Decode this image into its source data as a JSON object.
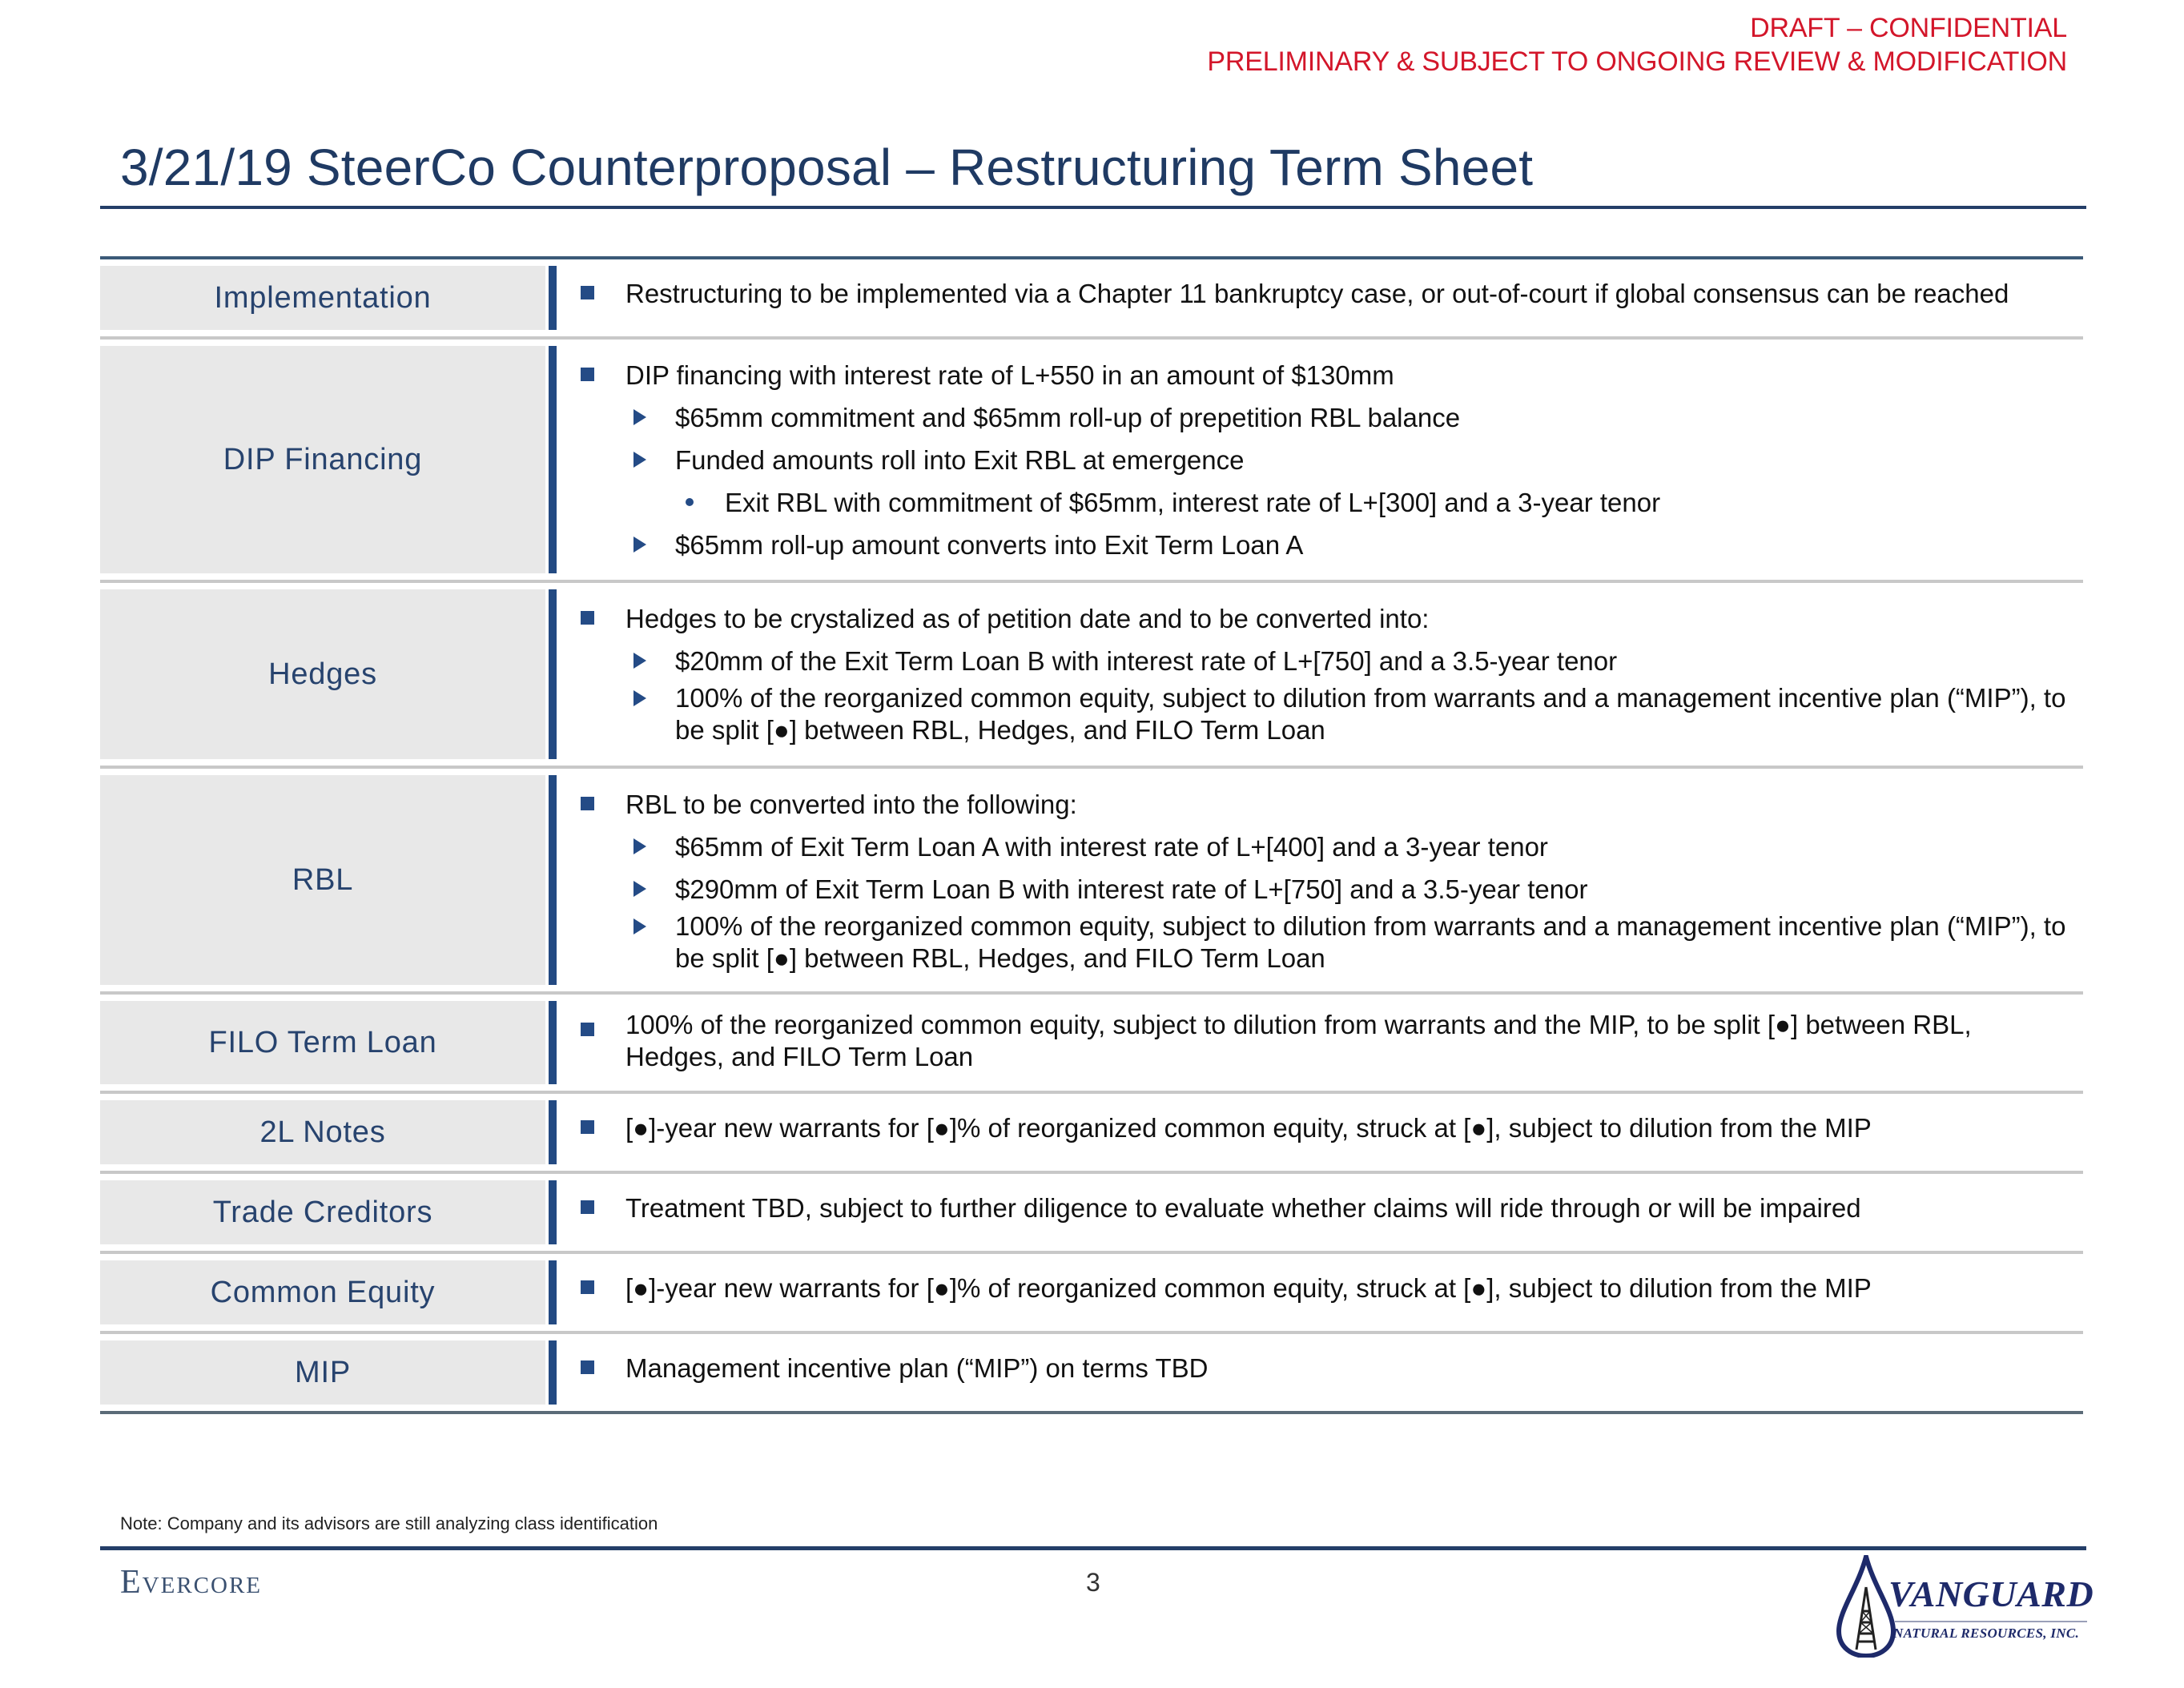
{
  "header": {
    "draft_line1": "DRAFT – CONFIDENTIAL",
    "draft_line2": "PRELIMINARY & SUBJECT TO ONGOING REVIEW & MODIFICATION",
    "title": "3/21/19 SteerCo Counterproposal – Restructuring Term Sheet"
  },
  "rows": [
    {
      "label": "Implementation",
      "items": [
        {
          "level": 1,
          "text": "Restructuring to be implemented via a Chapter 11 bankruptcy case, or out-of-court if global consensus can be reached"
        }
      ]
    },
    {
      "label": "DIP Financing",
      "items": [
        {
          "level": 1,
          "text": "DIP financing with interest rate of L+550 in an amount of $130mm"
        },
        {
          "level": 2,
          "text": "$65mm commitment and $65mm roll-up of prepetition RBL balance"
        },
        {
          "level": 2,
          "text": "Funded amounts roll into Exit RBL at emergence"
        },
        {
          "level": 3,
          "text": "Exit RBL with commitment of $65mm, interest rate of L+[300] and a 3-year tenor"
        },
        {
          "level": 2,
          "text": "$65mm roll-up amount converts into Exit Term Loan A"
        }
      ]
    },
    {
      "label": "Hedges",
      "items": [
        {
          "level": 1,
          "text": "Hedges to be crystalized as of petition date and to be converted into:"
        },
        {
          "level": 2,
          "text": "$20mm of the Exit Term Loan B with interest rate of L+[750] and a 3.5-year tenor"
        },
        {
          "level": 2,
          "text": "100% of the reorganized common equity, subject to dilution from warrants and a management incentive plan (“MIP”), to be split [●] between RBL, Hedges, and FILO Term Loan"
        }
      ]
    },
    {
      "label": "RBL",
      "items": [
        {
          "level": 1,
          "text": "RBL to be converted into the following:"
        },
        {
          "level": 2,
          "text": "$65mm of Exit Term Loan A with interest rate of L+[400] and a 3-year tenor"
        },
        {
          "level": 2,
          "text": "$290mm of Exit Term Loan B with interest rate of L+[750] and a 3.5-year tenor"
        },
        {
          "level": 2,
          "text": "100% of the reorganized common equity, subject to dilution from warrants and a management incentive plan (“MIP”), to be split [●] between RBL, Hedges, and FILO Term Loan"
        }
      ]
    },
    {
      "label": "FILO Term Loan",
      "items": [
        {
          "level": 1,
          "text": "100% of the reorganized common equity, subject to dilution from warrants and the MIP, to be split [●] between RBL, Hedges, and FILO Term Loan"
        }
      ]
    },
    {
      "label": "2L Notes",
      "items": [
        {
          "level": 1,
          "text": "[●]-year new warrants for [●]% of reorganized common equity, struck at [●], subject to dilution from the MIP"
        }
      ]
    },
    {
      "label": "Trade Creditors",
      "items": [
        {
          "level": 1,
          "text": "Treatment TBD, subject to further diligence to evaluate whether claims will ride through or will be impaired"
        }
      ]
    },
    {
      "label": "Common Equity",
      "items": [
        {
          "level": 1,
          "text": "[●]-year new warrants for [●]% of reorganized common equity, struck at [●], subject to dilution from the MIP"
        }
      ]
    },
    {
      "label": "MIP",
      "items": [
        {
          "level": 1,
          "text": "Management incentive plan (“MIP”) on terms TBD"
        }
      ]
    }
  ],
  "footer": {
    "note": "Note: Company and its advisors are still analyzing class identification",
    "left_brand": "Evercore",
    "page_number": "3",
    "right_brand_name": "VANGUARD",
    "right_brand_sub": "NATURAL RESOURCES, INC."
  },
  "colors": {
    "accent_navy": "#243e68",
    "label_text": "#27436e",
    "bullet_blue": "#244b86",
    "draft_red": "#d3162a",
    "label_bg": "#e8e8e8"
  }
}
